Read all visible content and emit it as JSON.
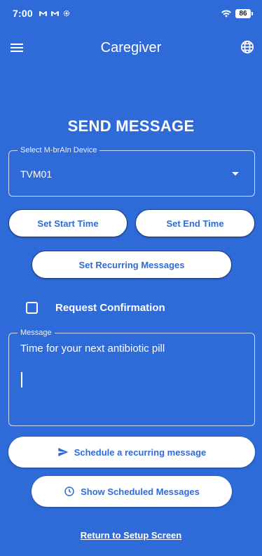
{
  "status_bar": {
    "time": "7:00",
    "icons": [
      "gmail-icon",
      "gmail-icon",
      "settings-gear-icon"
    ],
    "battery": "86"
  },
  "app_bar": {
    "title": "Caregiver",
    "menu_icon": "hamburger-menu-icon",
    "language_icon": "globe-icon"
  },
  "page": {
    "heading": "SEND MESSAGE"
  },
  "device_select": {
    "label": "Select M-brAIn Device",
    "value": "TVM01"
  },
  "buttons": {
    "start_time": "Set Start Time",
    "end_time": "Set End Time",
    "recurring": "Set Recurring Messages",
    "schedule": "Schedule a recurring message",
    "show_scheduled": "Show Scheduled Messages"
  },
  "confirmation": {
    "label": "Request Confirmation",
    "checked": false
  },
  "message": {
    "label": "Message",
    "value": "Time for your next antibiotic pill"
  },
  "return_link": "Return to Setup Screen",
  "colors": {
    "background": "#2f6bd8",
    "button_bg": "#ffffff",
    "button_text": "#2f6bd8"
  }
}
